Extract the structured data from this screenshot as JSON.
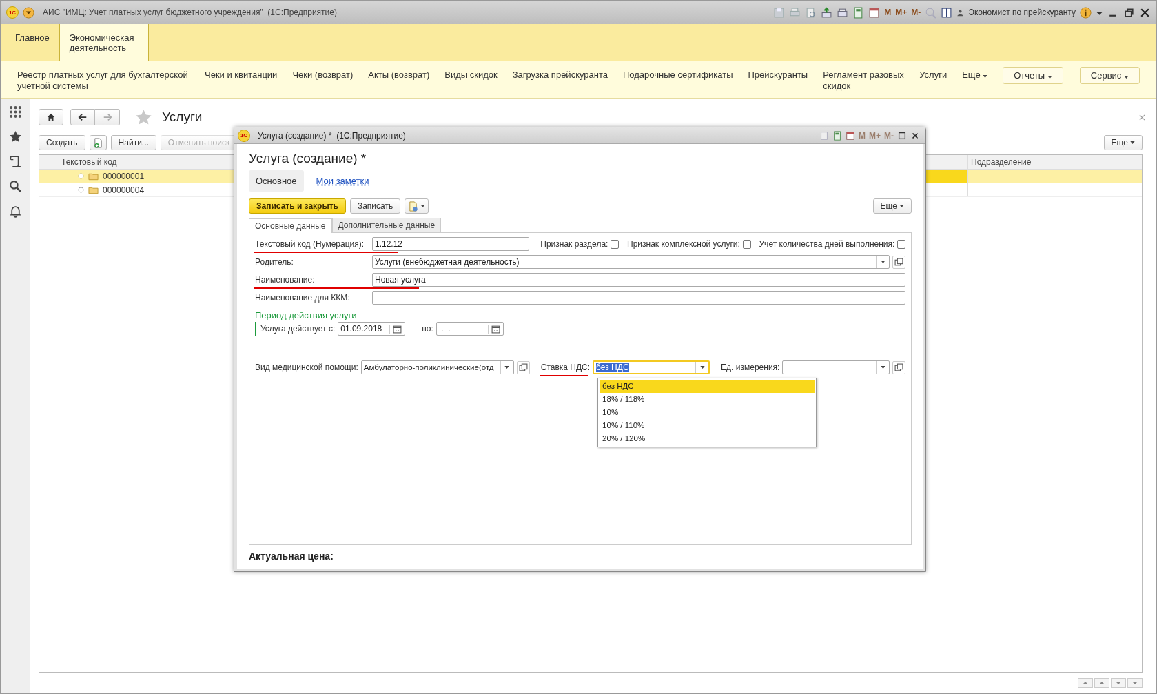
{
  "app": {
    "logo": "1С",
    "title": "АИС \"ИМЦ: Учет платных услуг бюджетного учреждения\"  (1С:Предприятие)",
    "memory_keys": [
      "M",
      "M+",
      "M-"
    ],
    "user": "Экономист по прейскуранту"
  },
  "sections": [
    {
      "label": "Главное",
      "selected": false
    },
    {
      "label": "Экономическая деятельность",
      "selected": true
    }
  ],
  "nav": {
    "links": [
      "Реестр платных услуг для бухгалтерской учетной системы",
      "Чеки и квитанции",
      "Чеки (возврат)",
      "Акты (возврат)",
      "Виды скидок",
      "Загрузка прейскуранта",
      "Подарочные сертификаты",
      "Прейскуранты",
      "Регламент разовых скидок",
      "Услуги"
    ],
    "more": "Еще",
    "buttons": [
      "Отчеты",
      "Сервис"
    ]
  },
  "list": {
    "title": "Услуги",
    "buttons": [
      {
        "kind": "text",
        "label": "Создать",
        "disabled": false
      },
      {
        "kind": "icon",
        "disabled": false
      },
      {
        "kind": "text",
        "label": "Найти...",
        "disabled": false
      },
      {
        "kind": "text",
        "label": "Отменить поиск",
        "disabled": true
      }
    ],
    "more": "Еще",
    "columns": [
      "Текстовый код",
      "Подразделение"
    ],
    "rows": [
      {
        "code": "000000001",
        "selected": true
      },
      {
        "code": "000000004",
        "selected": false
      }
    ]
  },
  "dialog": {
    "logo": "1С",
    "window_title": "Услуга (создание) *  (1С:Предприятие)",
    "memory_keys": [
      "M",
      "M+",
      "M-"
    ],
    "heading": "Услуга (создание) *",
    "tabs": [
      {
        "label": "Основное",
        "selected": true
      },
      {
        "label": "Мои заметки",
        "selected": false
      }
    ],
    "save_close": "Записать и закрыть",
    "save": "Записать",
    "more": "Еще",
    "inner_tabs": [
      {
        "label": "Основные данные",
        "selected": true
      },
      {
        "label": "Дополнительные данные",
        "selected": false
      }
    ],
    "code": {
      "label": "Текстовый код (Нумерация):",
      "value": "1.12.12",
      "underlined": true
    },
    "checkboxes": [
      {
        "label": "Признак раздела:",
        "checked": false
      },
      {
        "label": "Признак комплексной услуги:",
        "checked": false
      },
      {
        "label": "Учет количества дней выполнения:",
        "checked": false
      }
    ],
    "parent": {
      "label": "Родитель:",
      "value": "Услуги (внебюджетная деятельность)"
    },
    "name": {
      "label": "Наименование:",
      "value": "Новая услуга",
      "underlined": true
    },
    "kkm_name": {
      "label": "Наименование для ККМ:"
    },
    "period": {
      "title": "Период действия услуги",
      "from_label": "Услуга действует с:",
      "from": "01.09.2018",
      "to_label": "по:",
      "to": " .  ."
    },
    "care_type": {
      "label": "Вид медицинской помощи:",
      "value": "Амбулаторно-поликлинические(отд"
    },
    "vat": {
      "label": "Ставка НДС:",
      "value": "без НДС",
      "underlined": true
    },
    "unit": {
      "label": "Ед. измерения:"
    },
    "vat_options": [
      {
        "label": "без НДС",
        "selected": true
      },
      {
        "label": "18% / 118%",
        "selected": false
      },
      {
        "label": "10%",
        "selected": false
      },
      {
        "label": "10% / 110%",
        "selected": false
      },
      {
        "label": "20% / 120%",
        "selected": false
      }
    ],
    "price_label": "Актуальная цена:"
  }
}
